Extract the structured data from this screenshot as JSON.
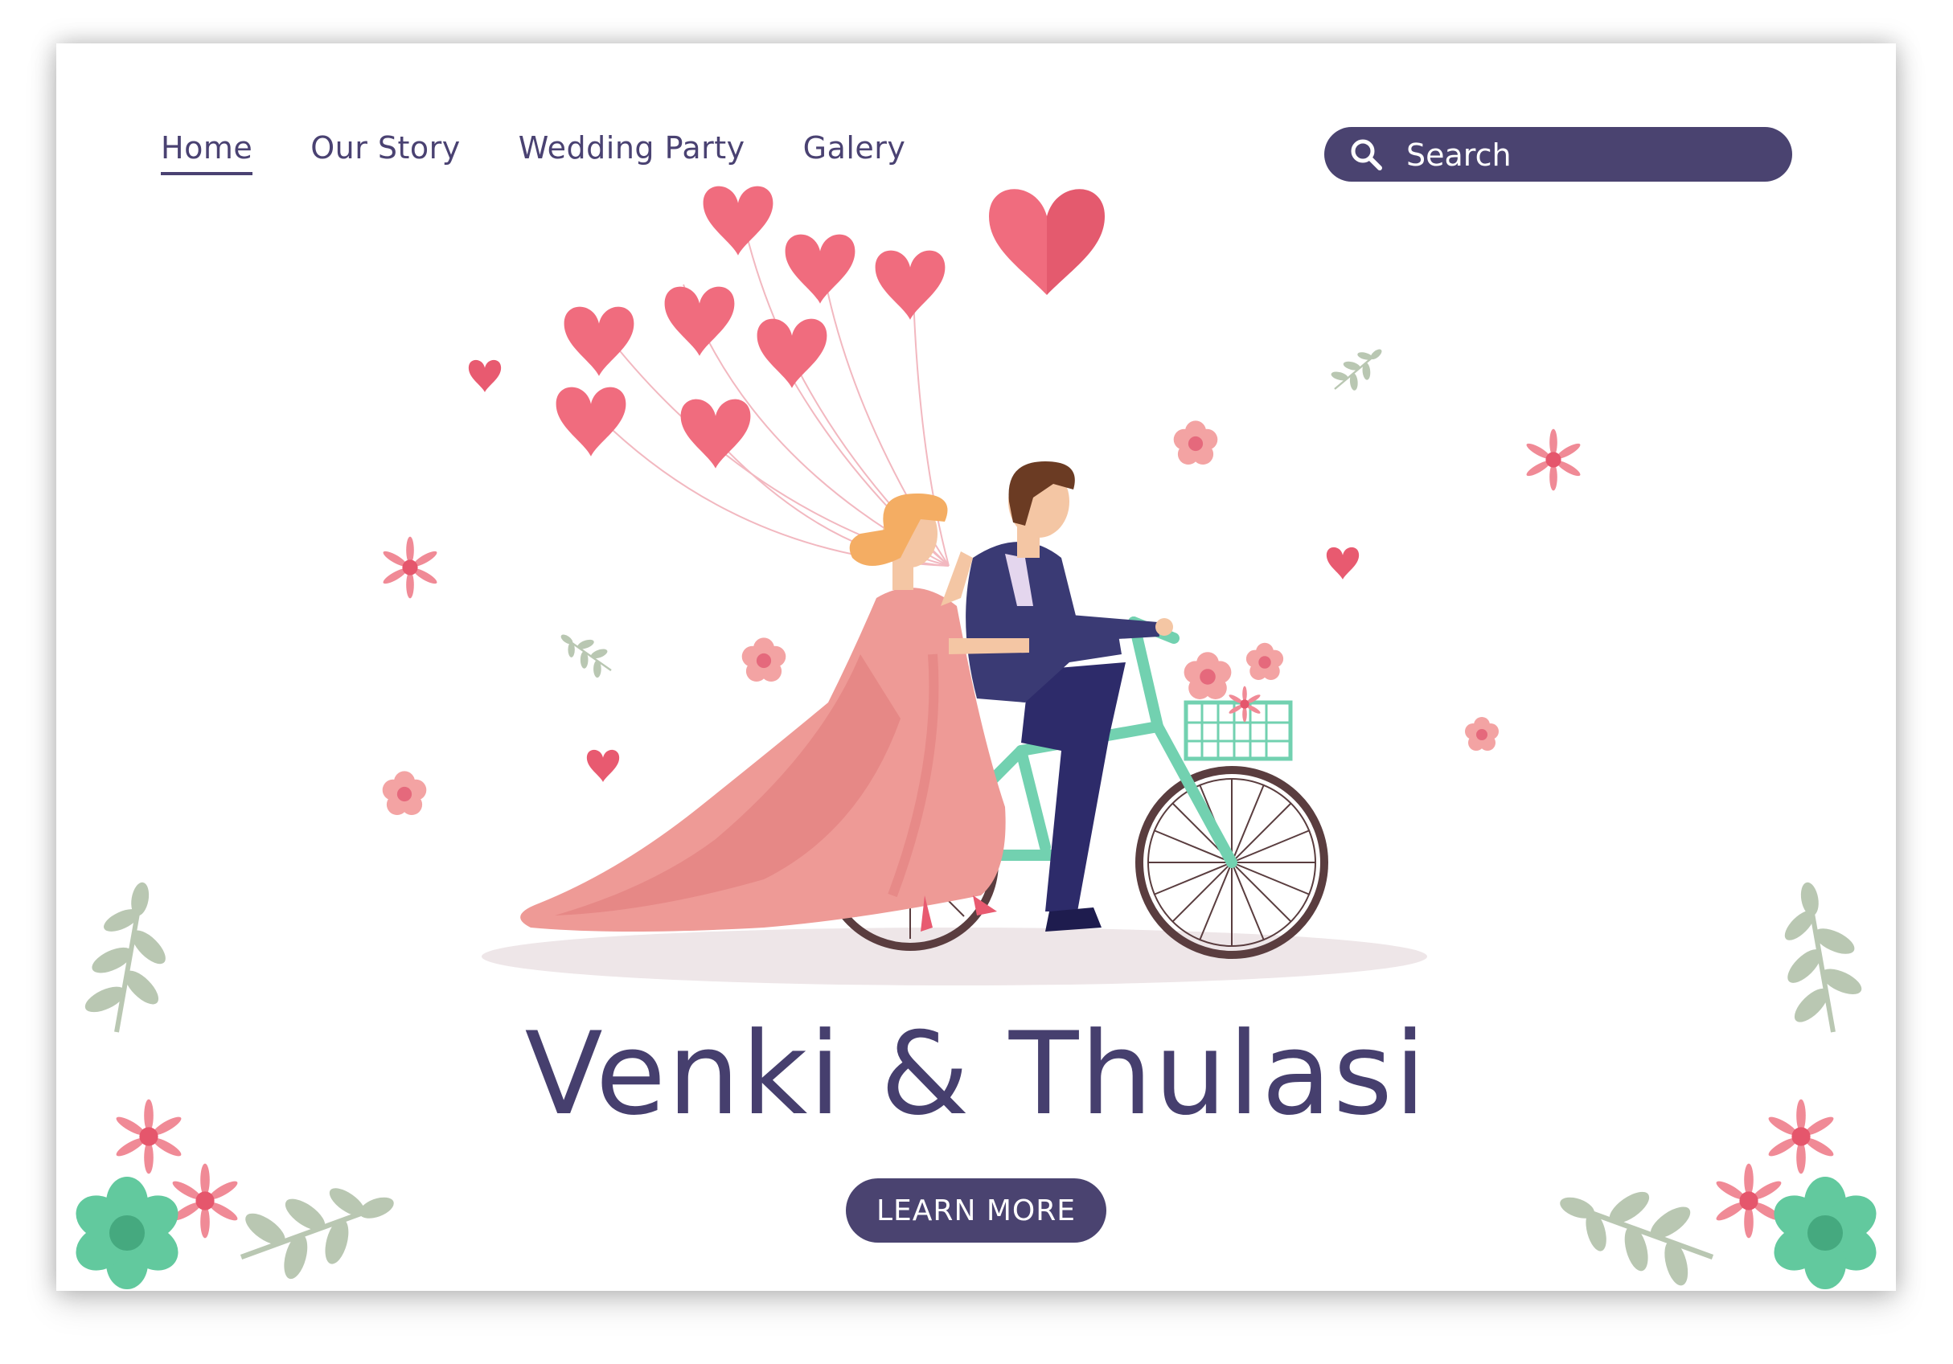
{
  "nav": {
    "items": [
      {
        "label": "Home",
        "active": true
      },
      {
        "label": "Our Story",
        "active": false
      },
      {
        "label": "Wedding Party",
        "active": false
      },
      {
        "label": "Galery",
        "active": false
      }
    ]
  },
  "search": {
    "placeholder": "Search",
    "icon": "search-icon"
  },
  "hero": {
    "title": "Venki & Thulasi",
    "cta_label": "LEARN MORE"
  },
  "colors": {
    "primary": "#4a4370",
    "heart": "#f06c7e",
    "dress": "#ee9a96",
    "bike": "#72d1b0",
    "leaf": "#b9c7b2",
    "flower_green": "#62c99e"
  }
}
